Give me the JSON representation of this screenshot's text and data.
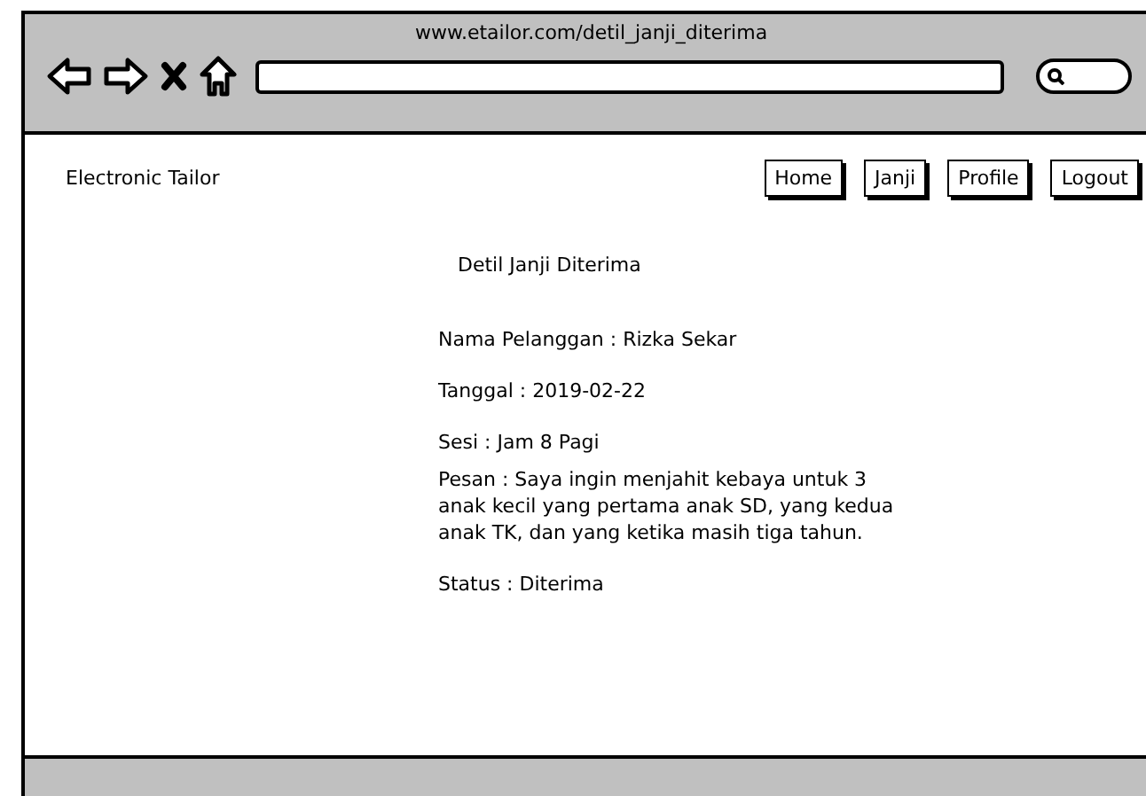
{
  "browser": {
    "url": "www.etailor.com/detil_janji_diterima"
  },
  "header": {
    "brand": "Electronic Tailor",
    "nav": [
      {
        "label": "Home"
      },
      {
        "label": "Janji"
      },
      {
        "label": "Profile"
      },
      {
        "label": "Logout"
      }
    ]
  },
  "content": {
    "title": "Detil Janji Diterima",
    "details": [
      "Nama Pelanggan : Rizka Sekar",
      "Tanggal : 2019-02-22",
      "Sesi : Jam 8 Pagi",
      "Pesan : Saya ingin menjahit kebaya untuk 3 anak kecil yang pertama anak SD, yang kedua anak TK, dan yang ketika masih tiga tahun.",
      "Status : Diterima"
    ]
  }
}
